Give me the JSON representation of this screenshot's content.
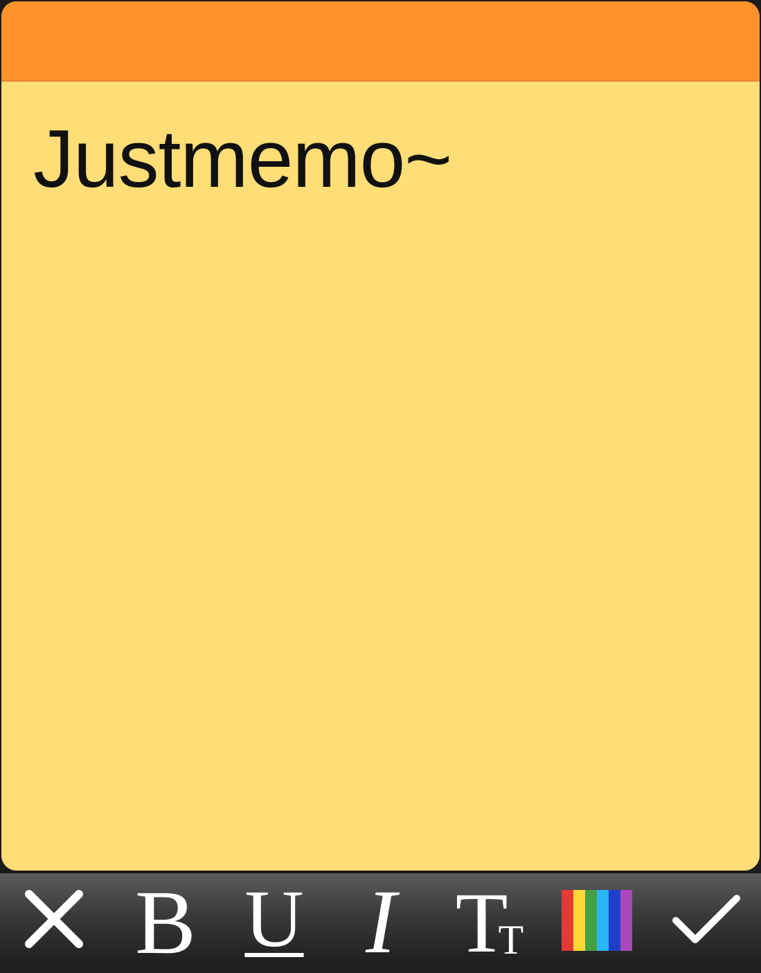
{
  "memo": {
    "text": "Justmemo~",
    "header_color": "#ff922b",
    "paper_color": "#ffdd77"
  },
  "toolbar": {
    "close_icon": "close-icon",
    "bold_label": "B",
    "underline_label": "U",
    "italic_label": "I",
    "font_size_label_large": "T",
    "font_size_label_small": "T",
    "color_icon": "color-palette-icon",
    "palette_colors": [
      "#e53935",
      "#fdd835",
      "#43a047",
      "#29b6f6",
      "#1e40c8",
      "#ab47bc"
    ],
    "confirm_icon": "checkmark-icon"
  }
}
